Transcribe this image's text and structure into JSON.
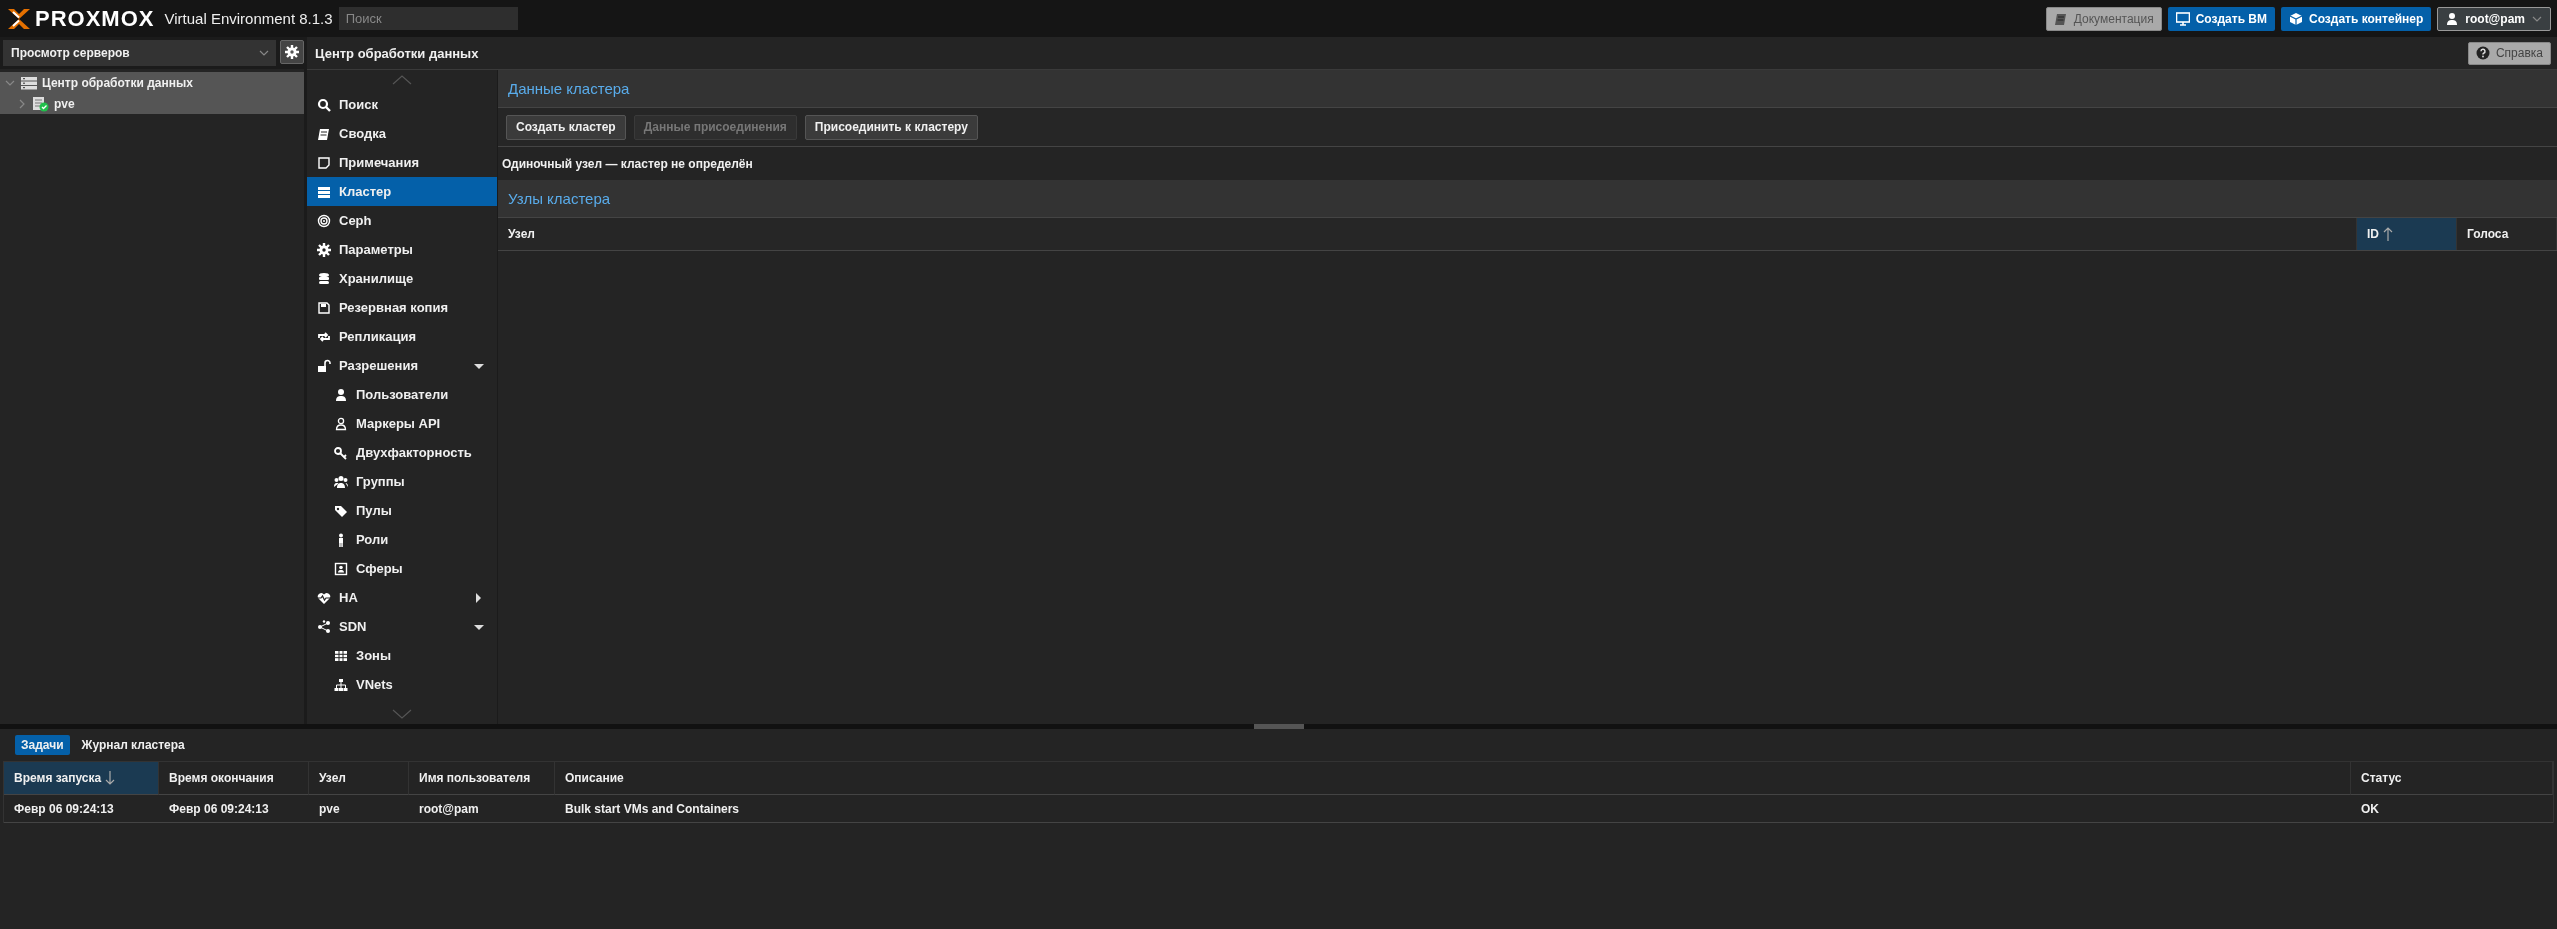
{
  "header": {
    "logo": "PROXMOX",
    "product": "Virtual Environment 8.1.3",
    "search": {
      "placeholder": "Поиск"
    },
    "buttons": [
      {
        "kind": "doc",
        "label": "Документация"
      },
      {
        "kind": "vm",
        "label": "Создать ВМ"
      },
      {
        "kind": "ct",
        "label": "Создать контейнер"
      },
      {
        "kind": "user",
        "label": "root@pam"
      }
    ]
  },
  "sidebar": {
    "view_selector": {
      "value": "Просмотр серверов"
    },
    "tree": [
      {
        "label": "Центр обработки данных",
        "selected": true,
        "expanded": true,
        "children": [
          {
            "label": "pve",
            "selected": true,
            "expanded": false,
            "online": true
          }
        ]
      }
    ]
  },
  "content": {
    "title": "Центр обработки данных",
    "help_button": "Справка",
    "nav": [
      {
        "label": "Поиск",
        "selected": false
      },
      {
        "label": "Сводка",
        "selected": false
      },
      {
        "label": "Примечания",
        "selected": false
      },
      {
        "label": "Кластер",
        "selected": true
      },
      {
        "label": "Ceph",
        "selected": false
      },
      {
        "label": "Параметры",
        "selected": false
      },
      {
        "label": "Хранилище",
        "selected": false
      },
      {
        "label": "Резервная копия",
        "selected": false
      },
      {
        "label": "Репликация",
        "selected": false
      },
      {
        "label": "Разрешения",
        "selected": false,
        "expanded": true,
        "children": [
          {
            "label": "Пользователи",
            "selected": false
          },
          {
            "label": "Маркеры API",
            "selected": false
          },
          {
            "label": "Двухфакторность",
            "selected": false
          },
          {
            "label": "Группы",
            "selected": false
          },
          {
            "label": "Пулы",
            "selected": false
          },
          {
            "label": "Роли",
            "selected": false
          },
          {
            "label": "Сферы",
            "selected": false
          }
        ]
      },
      {
        "label": "HA",
        "selected": false,
        "expanded": false
      },
      {
        "label": "SDN",
        "selected": false,
        "expanded": true,
        "children": [
          {
            "label": "Зоны",
            "selected": false
          },
          {
            "label": "VNets",
            "selected": false
          }
        ]
      }
    ],
    "cluster_info": {
      "title": "Данные кластера",
      "buttons": [
        {
          "label": "Создать кластер",
          "disabled": false
        },
        {
          "label": "Данные присоединения",
          "disabled": true
        },
        {
          "label": "Присоединить к кластеру",
          "disabled": false
        }
      ],
      "message": "Одиночный узел — кластер не определён"
    },
    "cluster_nodes": {
      "title": "Узлы кластера",
      "columns": [
        {
          "label": "Узел",
          "sorted": false
        },
        {
          "label": "ID",
          "sorted": true,
          "descending": false
        },
        {
          "label": "Голоса",
          "sorted": false
        }
      ]
    }
  },
  "bottom_panel": {
    "tabs": [
      {
        "label": "Задачи",
        "selected": true
      },
      {
        "label": "Журнал кластера",
        "selected": false
      }
    ],
    "columns": [
      {
        "label": "Время запуска",
        "sorted": true,
        "descending": true
      },
      {
        "label": "Время окончания",
        "sorted": false
      },
      {
        "label": "Узел",
        "sorted": false
      },
      {
        "label": "Имя пользователя",
        "sorted": false
      },
      {
        "label": "Описание",
        "sorted": false
      },
      {
        "label": "Статус",
        "sorted": false
      }
    ],
    "rows": [
      [
        "Февр 06 09:24:13",
        "Февр 06 09:24:13",
        "pve",
        "root@pam",
        "Bulk start VMs and Containers",
        "OK"
      ]
    ]
  }
}
